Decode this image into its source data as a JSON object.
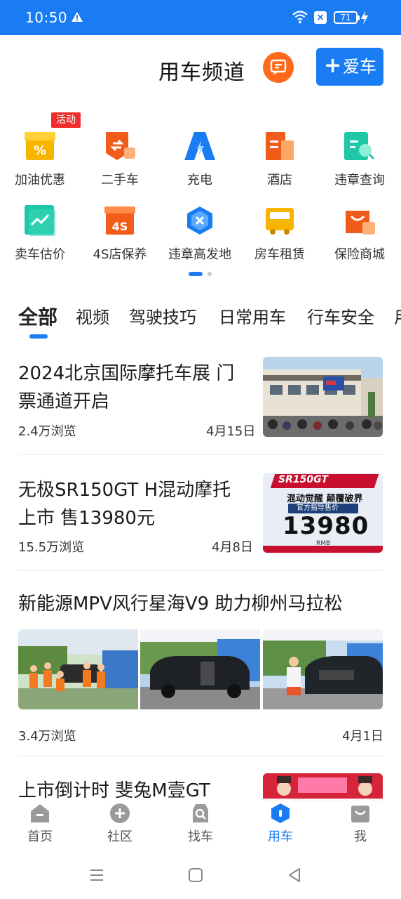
{
  "status": {
    "time": "10:50",
    "battery": "71"
  },
  "header": {
    "title": "用车频道",
    "add_car": "爱车"
  },
  "grid": {
    "badge": "活动",
    "items": [
      {
        "label": "加油优惠",
        "icon": "fuel-coupon-icon"
      },
      {
        "label": "二手车",
        "icon": "used-car-icon"
      },
      {
        "label": "充电",
        "icon": "charging-icon"
      },
      {
        "label": "酒店",
        "icon": "hotel-icon"
      },
      {
        "label": "违章查询",
        "icon": "violation-query-icon"
      },
      {
        "label": "卖车估价",
        "icon": "car-valuation-icon"
      },
      {
        "label": "4S店保养",
        "icon": "4s-maintenance-icon"
      },
      {
        "label": "违章高发地",
        "icon": "violation-hotspot-icon"
      },
      {
        "label": "房车租赁",
        "icon": "rv-rental-icon"
      },
      {
        "label": "保险商城",
        "icon": "insurance-mall-icon"
      }
    ]
  },
  "tabs": [
    "全部",
    "视频",
    "驾驶技巧",
    "日常用车",
    "行车安全",
    "用"
  ],
  "feed": [
    {
      "title_line1": "2024北京国际摩托车展 门",
      "title_line2": "票通道开启",
      "views": "2.4万浏览",
      "date": "4月15日"
    },
    {
      "title_line1": "无极SR150GT H混动摩托",
      "title_line2": "上市 售13980元",
      "views": "15.5万浏览",
      "date": "4月8日",
      "thumb": {
        "brand": "SR150GT",
        "slogan": "混动觉醒 颠覆破界",
        "tag": "官方指导售价",
        "price": "13980",
        "unit": "RMB"
      }
    },
    {
      "title": "新能源MPV风行星海V9 助力柳州马拉松",
      "views": "3.4万浏览",
      "date": "4月1日"
    },
    {
      "title": "上市倒计时 斐兔M壹GT"
    }
  ],
  "tabbar": [
    {
      "label": "首页",
      "icon": "home-icon"
    },
    {
      "label": "社区",
      "icon": "community-icon"
    },
    {
      "label": "找车",
      "icon": "find-car-icon"
    },
    {
      "label": "用车",
      "icon": "use-car-icon"
    },
    {
      "label": "我",
      "icon": "profile-icon"
    }
  ],
  "colors": {
    "primary": "#1a7cf2",
    "accent": "#ff6a1a",
    "badge": "#f02d2d"
  }
}
